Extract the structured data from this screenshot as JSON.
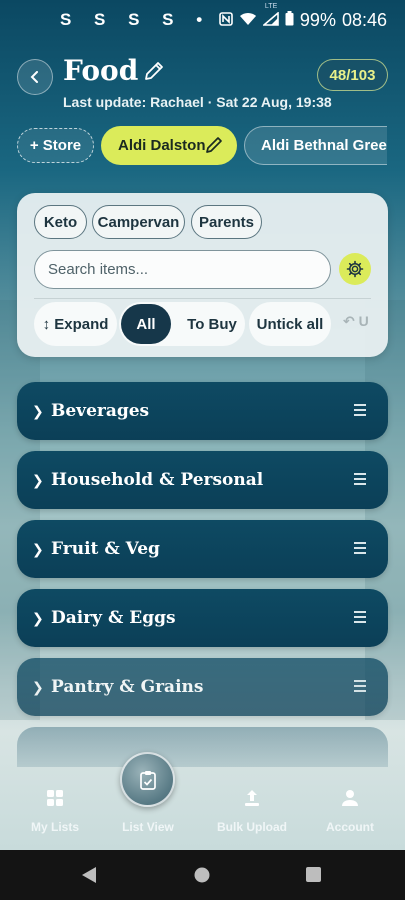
{
  "status_bar": {
    "left_text": "S S S S •",
    "battery": "99%",
    "time": "08:46",
    "network": "LTE"
  },
  "header": {
    "title": "Food",
    "subtitle": "Last update: Rachael · Sat 22 Aug, 19:38",
    "count_badge": "48/103"
  },
  "stores": {
    "add_label": "+ Store",
    "active": "Aldi Dalston",
    "other": "Aldi Bethnal Green",
    "more_glyph": "›"
  },
  "panel": {
    "tags": [
      "Keto",
      "Campervan",
      "Parents"
    ],
    "search_placeholder": "Search items...",
    "expand_label": "↕ Expand",
    "filter_all": "All",
    "filter_to_buy": "To Buy",
    "untick_all": "Untick all",
    "undo_label": "↶ U"
  },
  "categories": [
    {
      "name": "Beverages"
    },
    {
      "name": "Household & Personal"
    },
    {
      "name": "Fruit & Veg"
    },
    {
      "name": "Dairy & Eggs"
    },
    {
      "name": "Pantry & Grains"
    }
  ],
  "bottom_nav": {
    "my_lists": "My Lists",
    "list_view": "List View",
    "bulk_upload": "Bulk Upload",
    "account": "Account"
  },
  "colors": {
    "accent": "#dbeb5a",
    "category_bg": "#0e4a63",
    "badge_text": "#e8f08a"
  }
}
